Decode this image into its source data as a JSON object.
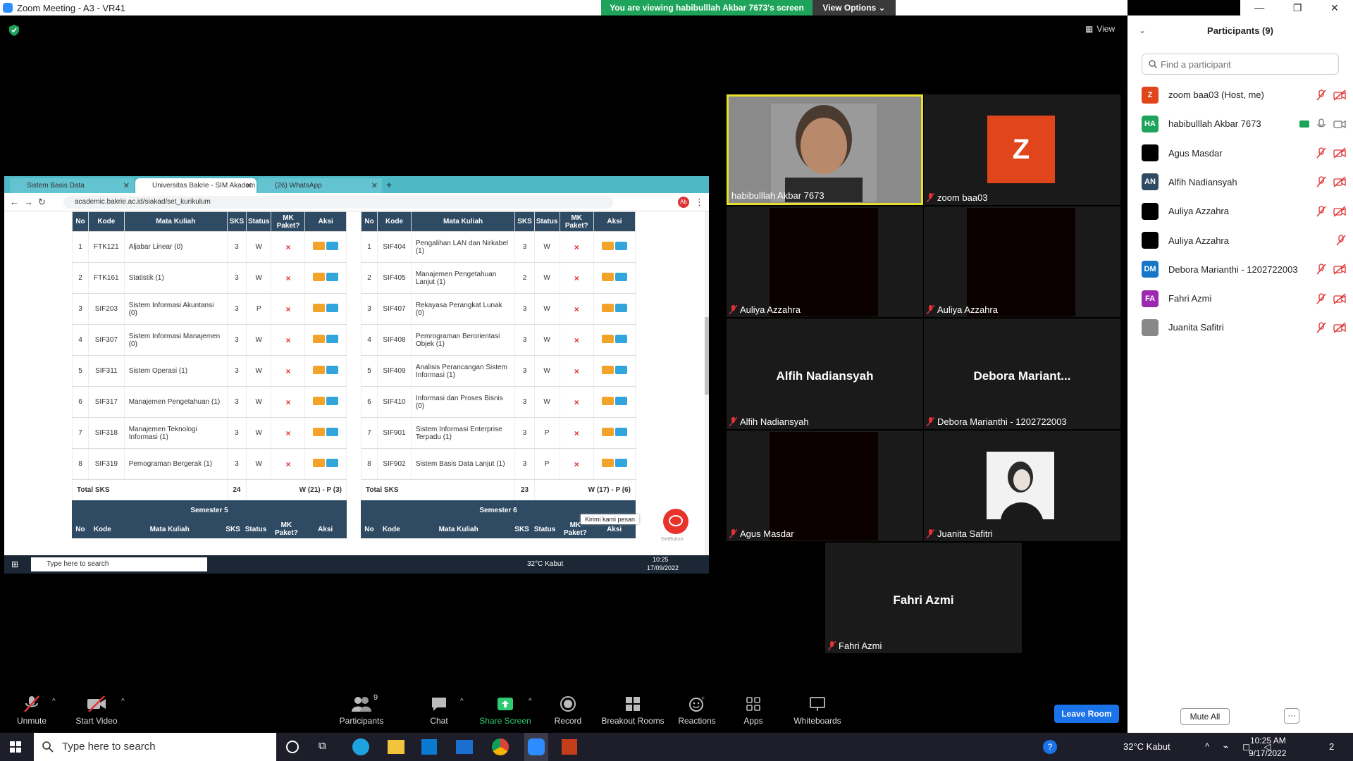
{
  "window": {
    "title": "Zoom Meeting - A3 - VR41"
  },
  "banner": {
    "viewing": "You are viewing habibulllah Akbar 7673's screen",
    "view_options": "View Options"
  },
  "view_button": "View",
  "browser": {
    "tabs": [
      "Sistem Basis Data",
      "Universitas Bakrie - SIM Akadem",
      "(26) WhatsApp"
    ],
    "url": "academic.bakrie.ac.id/siakad/set_kurikulum",
    "profile": "Ab"
  },
  "table_headers": [
    "No",
    "Kode",
    "Mata Kuliah",
    "SKS",
    "Status",
    "MK Paket?",
    "Aksi"
  ],
  "left_table": {
    "rows": [
      [
        "1",
        "FTK121",
        "Aljabar Linear (0)",
        "3",
        "W"
      ],
      [
        "2",
        "FTK161",
        "Statistik (1)",
        "3",
        "W"
      ],
      [
        "3",
        "SIF203",
        "Sistem Informasi Akuntansi (0)",
        "3",
        "P"
      ],
      [
        "4",
        "SIF307",
        "Sistem Informasi Manajemen (0)",
        "3",
        "W"
      ],
      [
        "5",
        "SIF311",
        "Sistem Operasi (1)",
        "3",
        "W"
      ],
      [
        "6",
        "SIF317",
        "Manajemen Pengetahuan (1)",
        "3",
        "W"
      ],
      [
        "7",
        "SIF318",
        "Manajemen Teknologi Informasi (1)",
        "3",
        "W"
      ],
      [
        "8",
        "SIF319",
        "Pemograman Bergerak (1)",
        "3",
        "W"
      ]
    ],
    "total_label": "Total SKS",
    "total_sks": "24",
    "total_status": "W (21) - P (3)"
  },
  "right_table": {
    "rows": [
      [
        "1",
        "SIF404",
        "Pengalihan LAN dan Nirkabel (1)",
        "3",
        "W"
      ],
      [
        "2",
        "SIF405",
        "Manajemen Pengetahuan Lanjut (1)",
        "2",
        "W"
      ],
      [
        "3",
        "SIF407",
        "Rekayasa Perangkat Lunak (0)",
        "3",
        "W"
      ],
      [
        "4",
        "SIF408",
        "Pemrograman Berorientasi Objek (1)",
        "3",
        "W"
      ],
      [
        "5",
        "SIF409",
        "Analisis Perancangan Sistem Informasi (1)",
        "3",
        "W"
      ],
      [
        "6",
        "SIF410",
        "Informasi dan Proses Bisnis (0)",
        "3",
        "W"
      ],
      [
        "7",
        "SIF901",
        "Sistem Informasi Enterprise Terpadu (1)",
        "3",
        "P"
      ],
      [
        "8",
        "SIF902",
        "Sistem Basis Data Lanjut (1)",
        "3",
        "P"
      ]
    ],
    "total_label": "Total SKS",
    "total_sks": "23",
    "total_status": "W (17) - P (6)"
  },
  "delete_glyph": "×",
  "semesters": {
    "left": "Semester 5",
    "right": "Semester 6"
  },
  "chat_widget": {
    "label": "Kirimi kami pesan",
    "brand": "GetButton"
  },
  "inner_taskbar": {
    "search": "Type here to search",
    "weather": "32°C  Kabut",
    "time": "10:25",
    "date": "17/09/2022"
  },
  "tiles": {
    "habib": "habibulllah Akbar 7673",
    "zoom": "zoom baa03",
    "zoom_initial": "Z",
    "auliya1": "Auliya Azzahra",
    "auliya2": "Auliya Azzahra",
    "alfih_big": "Alfih Nadiansyah",
    "alfih": "Alfih Nadiansyah",
    "debora_big": "Debora  Mariant...",
    "debora": "Debora Marianthi - 1202722003",
    "agus": "Agus Masdar",
    "juanita": "Juanita Safitri",
    "fahri_big": "Fahri Azmi",
    "fahri": "Fahri Azmi"
  },
  "toolbar": {
    "unmute": "Unmute",
    "start_video": "Start Video",
    "participants": "Participants",
    "participants_count": "9",
    "chat": "Chat",
    "share_screen": "Share Screen",
    "record": "Record",
    "breakout": "Breakout Rooms",
    "reactions": "Reactions",
    "apps": "Apps",
    "whiteboards": "Whiteboards",
    "leave": "Leave Room"
  },
  "panel": {
    "title": "Participants (9)",
    "find_placeholder": "Find a participant",
    "participants": [
      {
        "initials": "Z",
        "name": "zoom baa03 (Host, me)",
        "color": "#e0451b"
      },
      {
        "initials": "HA",
        "name": "habibulllah Akbar 7673",
        "color": "#1ea45a"
      },
      {
        "initials": "",
        "name": "Agus Masdar",
        "color": "#000000"
      },
      {
        "initials": "AN",
        "name": "Alfih Nadiansyah",
        "color": "#2f4b63"
      },
      {
        "initials": "",
        "name": "Auliya Azzahra",
        "color": "#000000"
      },
      {
        "initials": "",
        "name": "Auliya Azzahra",
        "color": "#000000"
      },
      {
        "initials": "DM",
        "name": "Debora Marianthi - 1202722003",
        "color": "#1677c9"
      },
      {
        "initials": "FA",
        "name": "Fahri Azmi",
        "color": "#9c27b0"
      },
      {
        "initials": "",
        "name": "Juanita Safitri",
        "color": "#888888"
      }
    ],
    "mute_all": "Mute All",
    "more": "···"
  },
  "taskbar": {
    "search": "Type here to search",
    "weather": "32°C  Kabut",
    "time": "10:25 AM",
    "date": "9/17/2022",
    "notif": "2"
  }
}
